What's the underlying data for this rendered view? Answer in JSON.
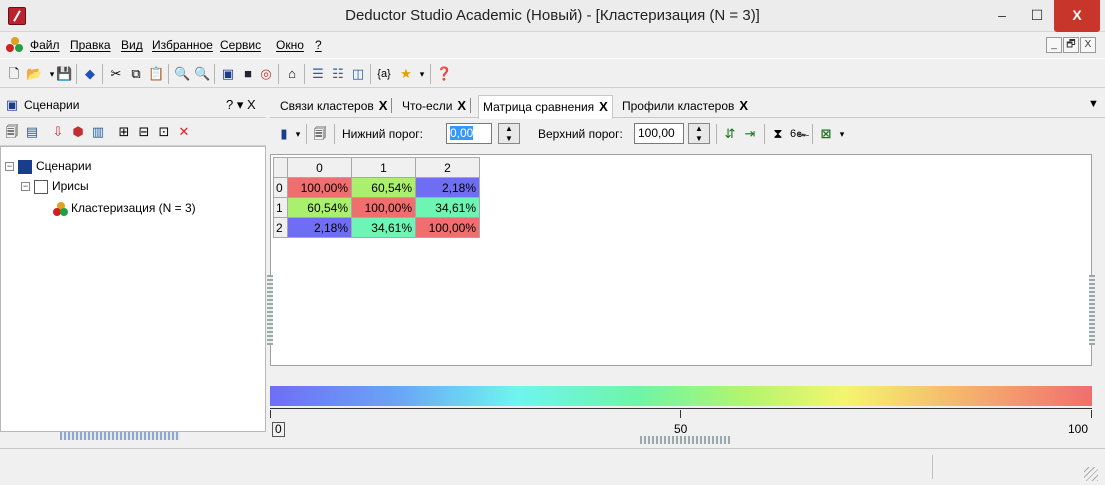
{
  "window": {
    "title": "Deductor Studio Academic (Новый) - [Кластеризация (N = 3)]",
    "minimize": "–",
    "maximize": "☐",
    "close": "X"
  },
  "menu": {
    "items": [
      "Файл",
      "Правка",
      "Вид",
      "Избранное",
      "Сервис",
      "Окно",
      "?"
    ],
    "mdi": [
      "_",
      "🗗",
      "X"
    ]
  },
  "scenarios_panel": {
    "title": "Сценарии",
    "controls": "? ▾ X",
    "tree": [
      {
        "label": "Сценарии",
        "level": 0
      },
      {
        "label": "Ирисы",
        "level": 1
      },
      {
        "label": "Кластеризация (N = 3)",
        "level": 2
      }
    ]
  },
  "tabs": [
    {
      "label": "Связи кластеров",
      "close": "X"
    },
    {
      "label": "Что-если",
      "close": "X"
    },
    {
      "label": "Матрица сравнения",
      "close": "X",
      "active": true
    },
    {
      "label": "Профили кластеров",
      "close": "X"
    }
  ],
  "matrix_toolbar": {
    "lower_label": "Нижний порог:",
    "lower_value": "0,00",
    "upper_label": "Верхний порог:",
    "upper_value": "100,00"
  },
  "matrix": {
    "columns": [
      "0",
      "1",
      "2"
    ],
    "rows": [
      {
        "label": "0",
        "cells": [
          {
            "value": "100,00%",
            "color": "#f06e6e"
          },
          {
            "value": "60,54%",
            "color": "#a9f06e"
          },
          {
            "value": "2,18%",
            "color": "#6e6ef5"
          }
        ]
      },
      {
        "label": "1",
        "cells": [
          {
            "value": "60,54%",
            "color": "#a9f06e"
          },
          {
            "value": "100,00%",
            "color": "#f06e6e"
          },
          {
            "value": "34,61%",
            "color": "#6ef5b4"
          }
        ]
      },
      {
        "label": "2",
        "cells": [
          {
            "value": "2,18%",
            "color": "#6e6ef5"
          },
          {
            "value": "34,61%",
            "color": "#6ef5b4"
          },
          {
            "value": "100,00%",
            "color": "#f06e6e"
          }
        ]
      }
    ]
  },
  "legend": {
    "min": "0",
    "mid": "50",
    "max": "100"
  }
}
